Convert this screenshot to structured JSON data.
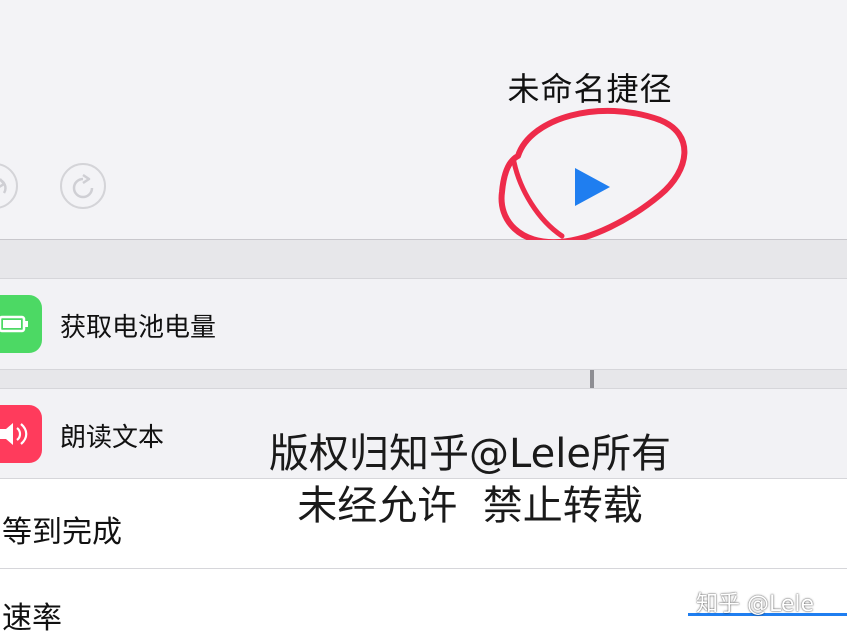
{
  "header": {
    "title": "未命名捷径",
    "undo_icon": "undo-icon",
    "redo_icon": "redo-icon",
    "play_icon": "play-icon"
  },
  "actions": [
    {
      "label": "获取电池电量",
      "icon": "battery-icon",
      "color": "#4cd964"
    },
    {
      "label": "朗读文本",
      "icon": "speaker-icon",
      "color": "#ff3b5c"
    }
  ],
  "settings": [
    {
      "label": "等到完成"
    },
    {
      "label": "速率"
    }
  ],
  "watermark": {
    "line1": "版权归知乎@Lele所有",
    "line2": "未经允许  禁止转载",
    "zhihu": "知乎 @Lele"
  },
  "colors": {
    "accent": "#1f7ef0",
    "annotation": "#ee2b4a"
  }
}
